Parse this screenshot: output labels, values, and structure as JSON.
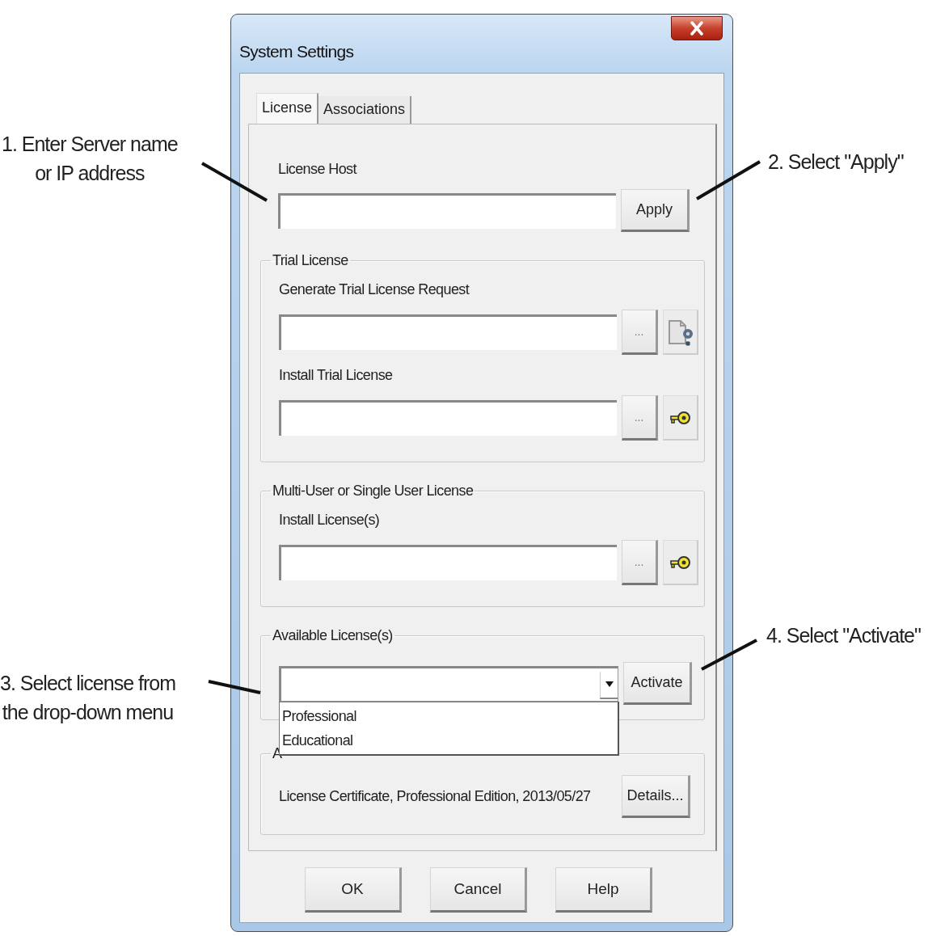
{
  "annotations": [
    {
      "text": "1. Enter Server name\nor IP address"
    },
    {
      "text": "2. Select \"Apply\""
    },
    {
      "text": "3. Select license from\nthe drop-down menu"
    },
    {
      "text": "4. Select \"Activate\""
    }
  ],
  "window": {
    "title": "System Settings"
  },
  "tabs": [
    {
      "label": "License",
      "selected": true
    },
    {
      "label": "Associations",
      "selected": false
    }
  ],
  "license_host": {
    "label": "License Host",
    "button": "Apply"
  },
  "groups": [
    {
      "title": "Trial License",
      "rows": [
        {
          "label": "Generate Trial License Request",
          "browse_button": "...",
          "kind": "document"
        },
        {
          "label": "Install Trial License",
          "browse_button": "...",
          "kind": "key"
        }
      ]
    },
    {
      "title": "Multi-User or Single User License",
      "rows": [
        {
          "label": "Install License(s)",
          "browse_button": "...",
          "kind": "key"
        }
      ]
    }
  ],
  "available_licenses": {
    "title": "Available License(s)",
    "button": "Activate",
    "dropdown_open": true,
    "options": [
      {
        "label": "Professional",
        "selected": false
      },
      {
        "label": "Educational",
        "selected": false
      }
    ]
  },
  "active_license": {
    "title": "A",
    "text": "License Certificate,  Professional Edition,  2013/05/27",
    "button": "Details..."
  },
  "footer_buttons": [
    "OK",
    "Cancel",
    "Help"
  ]
}
